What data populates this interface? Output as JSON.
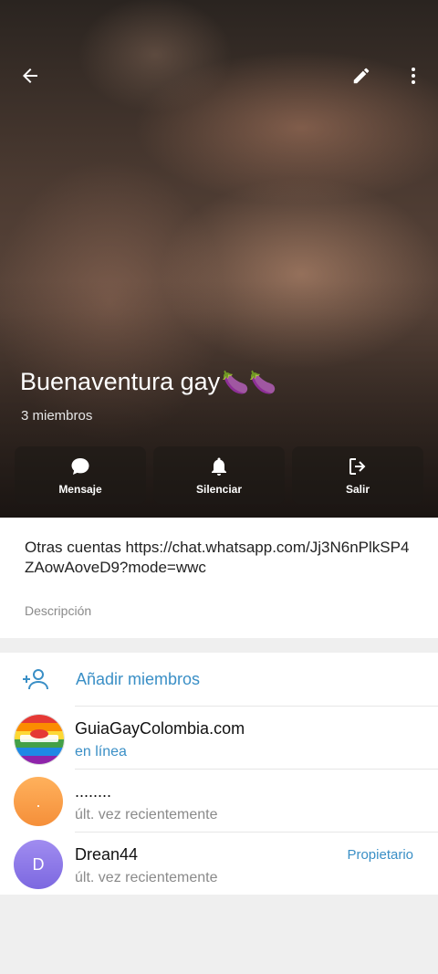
{
  "group": {
    "title": "Buenaventura gay",
    "title_emoji": "🍆🍆",
    "members_count": "3 miembros"
  },
  "actions": {
    "message": "Mensaje",
    "mute": "Silenciar",
    "leave": "Salir"
  },
  "description": {
    "text": "Otras cuentas https://chat.whatsapp.com/Jj3N6nPlkSP4ZAowAoveD9?mode=wwc",
    "caption": "Descripción"
  },
  "add_members": "Añadir miembros",
  "members": [
    {
      "name": "GuiaGayColombia.com",
      "status": "en línea",
      "role": "",
      "avatar_letter": ""
    },
    {
      "name": "........",
      "status": "últ. vez recientemente",
      "role": "",
      "avatar_letter": "."
    },
    {
      "name": "Drean44",
      "status": "últ. vez recientemente",
      "role": "Propietario",
      "avatar_letter": "D"
    }
  ],
  "colors": {
    "accent": "#3a8fc6",
    "avatar_orange": "#f7a04a",
    "avatar_purple": "#8f7be8"
  }
}
